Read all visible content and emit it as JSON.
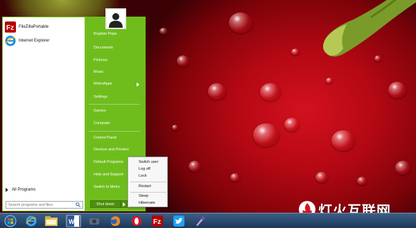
{
  "start_menu": {
    "pinned": [
      {
        "label": "FileZillaPortable",
        "icon": "filezilla-icon"
      },
      {
        "label": "Internet Explorer",
        "icon": "internet-explorer-icon"
      }
    ],
    "all_programs_label": "All Programs",
    "search_placeholder": "Search programs and files",
    "user_name": "Bogdan Popa",
    "links": {
      "documents": "Documents",
      "pictures": "Pictures",
      "music": "Music",
      "metro_apps": "MetroApps",
      "settings": "Settings",
      "games": "Games",
      "computer": "Computer",
      "control_panel": "Control Panel",
      "devices_and_printers": "Devices and Printers",
      "default_programs": "Default Programs",
      "help_and_support": "Help and Support",
      "switch_to_metro": "Switch to Metro"
    },
    "shutdown_label": "Shut down"
  },
  "power_menu": {
    "items": [
      "Switch user",
      "Log off",
      "Lock",
      "Restart",
      "Sleep",
      "Hibernate"
    ]
  },
  "taskbar": {
    "icons": [
      "start-orb-icon",
      "internet-explorer-icon",
      "file-explorer-icon",
      "word-icon",
      "app-icon",
      "firefox-icon",
      "opera-icon",
      "filezilla-icon",
      "twitter-icon",
      "paint-icon"
    ]
  },
  "watermark": {
    "text": "灯火互联网"
  },
  "colors": {
    "menu_green": "#6fbd1d",
    "menu_green_dark": "#4f8f0f",
    "taskbar_blue": "#1d3858"
  }
}
